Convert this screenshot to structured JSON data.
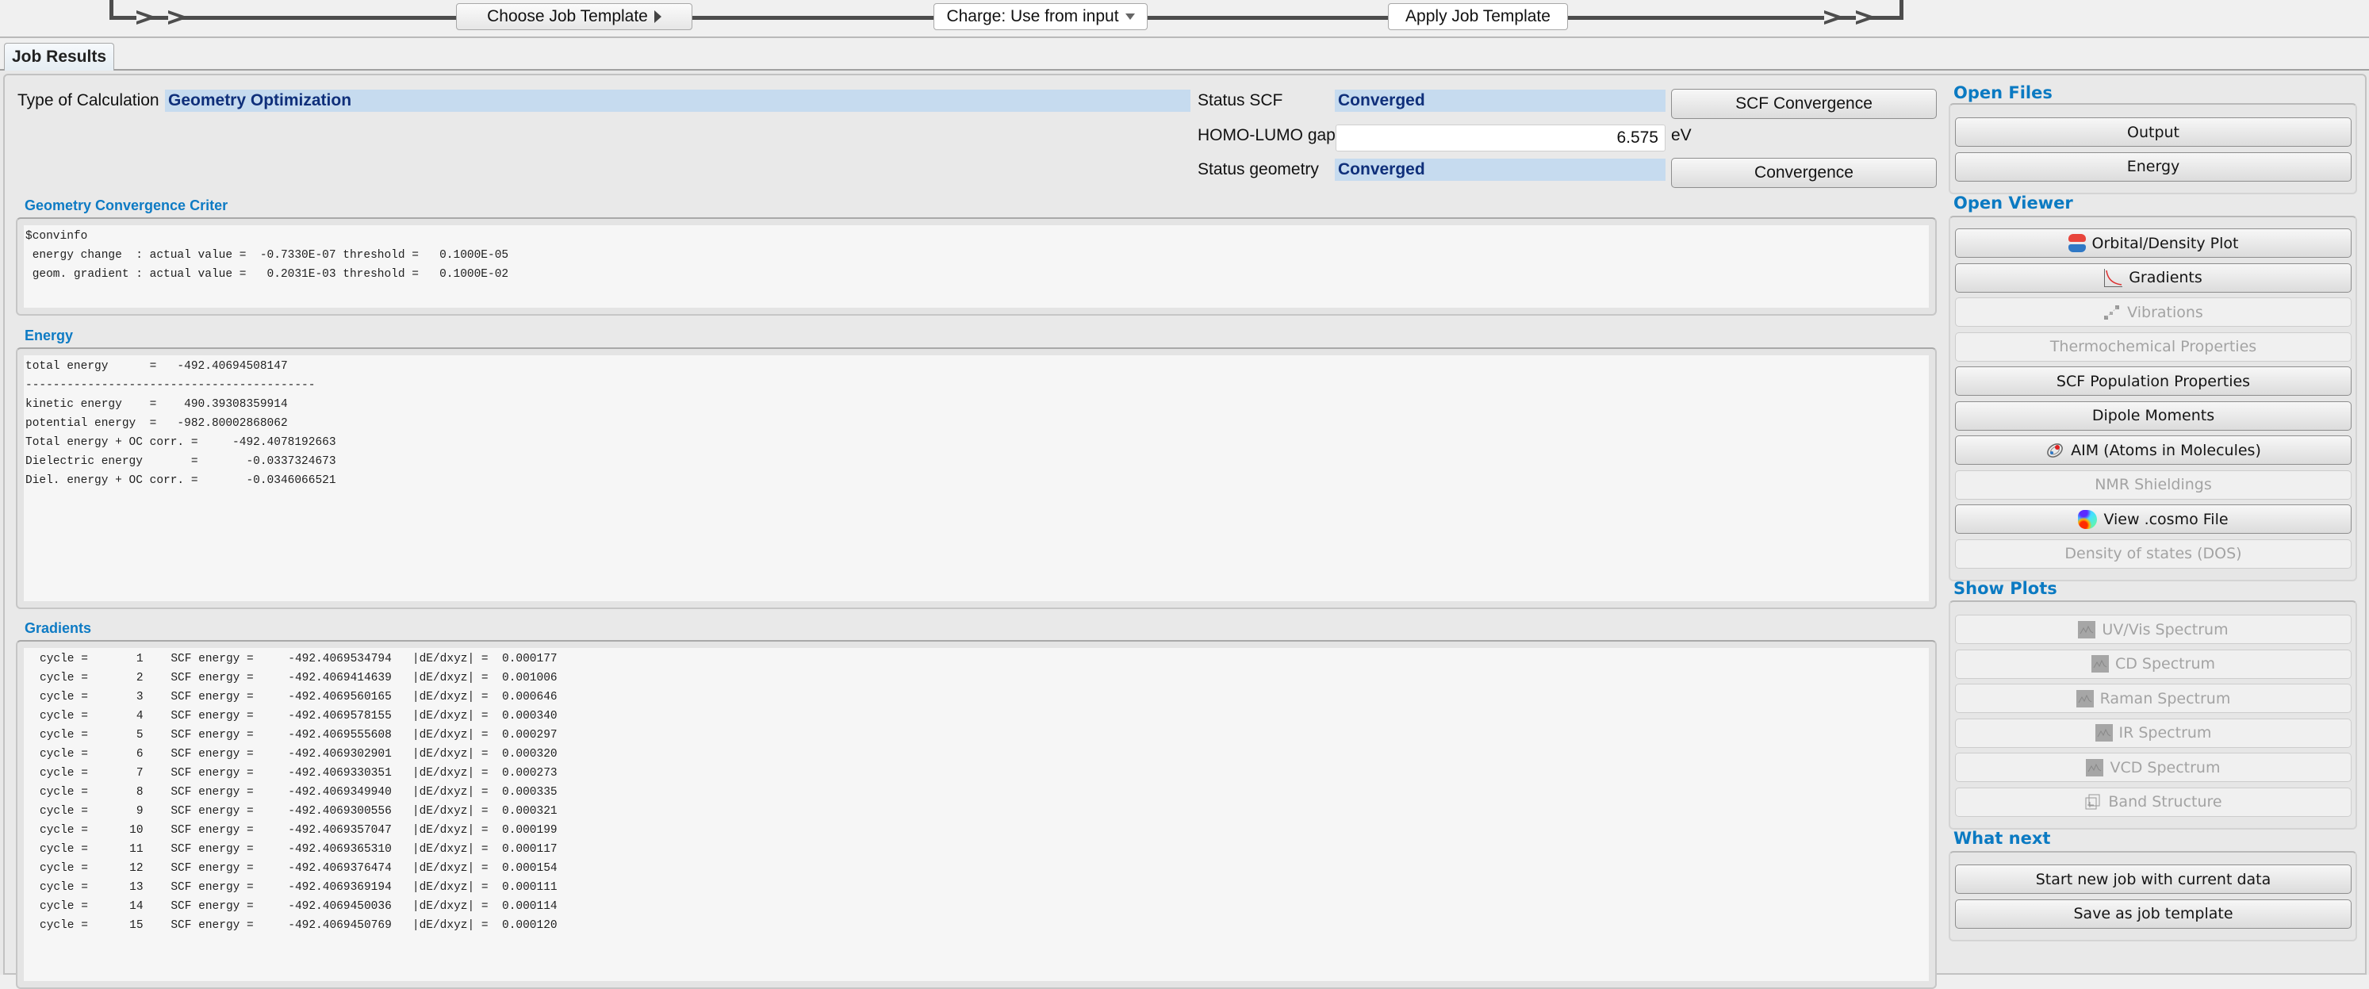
{
  "workflow": {
    "choose_template": "Choose Job Template",
    "charge": "Charge:  Use from input",
    "apply_template": "Apply Job Template"
  },
  "tabs": [
    {
      "label": "Job Results",
      "active": true
    }
  ],
  "summary": {
    "type_label": "Type of Calculation",
    "type_value": "Geometry Optimization",
    "status_scf_label": "Status SCF",
    "status_scf_value": "Converged",
    "homo_lumo_label": "HOMO-LUMO gap",
    "homo_lumo_value": "6.575",
    "homo_lumo_unit": "eV",
    "status_geom_label": "Status geometry",
    "status_geom_value": "Converged",
    "scf_convergence_button": "SCF Convergence",
    "convergence_button": "Convergence"
  },
  "geometry_convergence": {
    "title": "Geometry Convergence Criter",
    "lines": [
      "$convinfo",
      " energy change  : actual value =  -0.7330E-07 threshold =   0.1000E-05",
      " geom. gradient : actual value =   0.2031E-03 threshold =   0.1000E-02"
    ]
  },
  "energy": {
    "title": "Energy",
    "lines": [
      "total energy      =   -492.40694508147",
      "------------------------------------------",
      "kinetic energy    =    490.39308359914",
      "potential energy  =   -982.80002868062",
      "Total energy + OC corr. =     -492.4078192663",
      "Dielectric energy       =       -0.0337324673",
      "Diel. energy + OC corr. =       -0.0346066521"
    ]
  },
  "gradients": {
    "title": "Gradients",
    "rows": [
      {
        "cycle": "1",
        "scf_energy": "-492.4069534794",
        "dE_dxyz": "0.000177"
      },
      {
        "cycle": "2",
        "scf_energy": "-492.4069414639",
        "dE_dxyz": "0.001006"
      },
      {
        "cycle": "3",
        "scf_energy": "-492.4069560165",
        "dE_dxyz": "0.000646"
      },
      {
        "cycle": "4",
        "scf_energy": "-492.4069578155",
        "dE_dxyz": "0.000340"
      },
      {
        "cycle": "5",
        "scf_energy": "-492.4069555608",
        "dE_dxyz": "0.000297"
      },
      {
        "cycle": "6",
        "scf_energy": "-492.4069302901",
        "dE_dxyz": "0.000320"
      },
      {
        "cycle": "7",
        "scf_energy": "-492.4069330351",
        "dE_dxyz": "0.000273"
      },
      {
        "cycle": "8",
        "scf_energy": "-492.4069349940",
        "dE_dxyz": "0.000335"
      },
      {
        "cycle": "9",
        "scf_energy": "-492.4069300556",
        "dE_dxyz": "0.000321"
      },
      {
        "cycle": "10",
        "scf_energy": "-492.4069357047",
        "dE_dxyz": "0.000199"
      },
      {
        "cycle": "11",
        "scf_energy": "-492.4069365310",
        "dE_dxyz": "0.000117"
      },
      {
        "cycle": "12",
        "scf_energy": "-492.4069376474",
        "dE_dxyz": "0.000154"
      },
      {
        "cycle": "13",
        "scf_energy": "-492.4069369194",
        "dE_dxyz": "0.000111"
      },
      {
        "cycle": "14",
        "scf_energy": "-492.4069450036",
        "dE_dxyz": "0.000114"
      },
      {
        "cycle": "15",
        "scf_energy": "-492.4069450769",
        "dE_dxyz": "0.000120"
      }
    ]
  },
  "right_panel": {
    "open_files": {
      "title": "Open Files",
      "buttons": [
        {
          "label": "Output",
          "enabled": true
        },
        {
          "label": "Energy",
          "enabled": true
        }
      ]
    },
    "open_viewer": {
      "title": "Open Viewer",
      "buttons": [
        {
          "label": "Orbital/Density Plot",
          "icon": "orbital-icon",
          "enabled": true
        },
        {
          "label": "Gradients",
          "icon": "gradient-plot-icon",
          "enabled": true
        },
        {
          "label": "Vibrations",
          "icon": "vibrations-icon",
          "enabled": false
        },
        {
          "label": "Thermochemical Properties",
          "enabled": false
        },
        {
          "label": "SCF Population Properties",
          "enabled": true
        },
        {
          "label": "Dipole Moments",
          "enabled": true
        },
        {
          "label": "AIM (Atoms in Molecules)",
          "icon": "aim-icon",
          "enabled": true
        },
        {
          "label": "NMR Shieldings",
          "enabled": false
        },
        {
          "label": "View .cosmo File",
          "icon": "cosmo-icon",
          "enabled": true
        },
        {
          "label": "Density of states (DOS)",
          "enabled": false
        }
      ]
    },
    "show_plots": {
      "title": "Show Plots",
      "buttons": [
        {
          "label": "UV/Vis Spectrum",
          "icon": "spectrum-icon",
          "enabled": false
        },
        {
          "label": "CD Spectrum",
          "icon": "spectrum-icon",
          "enabled": false
        },
        {
          "label": "Raman Spectrum",
          "icon": "spectrum-icon",
          "enabled": false
        },
        {
          "label": "IR Spectrum",
          "icon": "spectrum-icon",
          "enabled": false
        },
        {
          "label": "VCD Spectrum",
          "icon": "spectrum-icon",
          "enabled": false
        },
        {
          "label": "Band Structure",
          "icon": "band-structure-icon",
          "enabled": false
        }
      ]
    },
    "what_next": {
      "title": "What next",
      "buttons": [
        {
          "label": "Start new job with current data",
          "enabled": true
        },
        {
          "label": "Save as job template",
          "enabled": true
        }
      ]
    }
  },
  "colors": {
    "section_title": "#0e7bc4",
    "highlight_bg": "#c6dbef",
    "highlight_text": "#0f2f7a"
  }
}
